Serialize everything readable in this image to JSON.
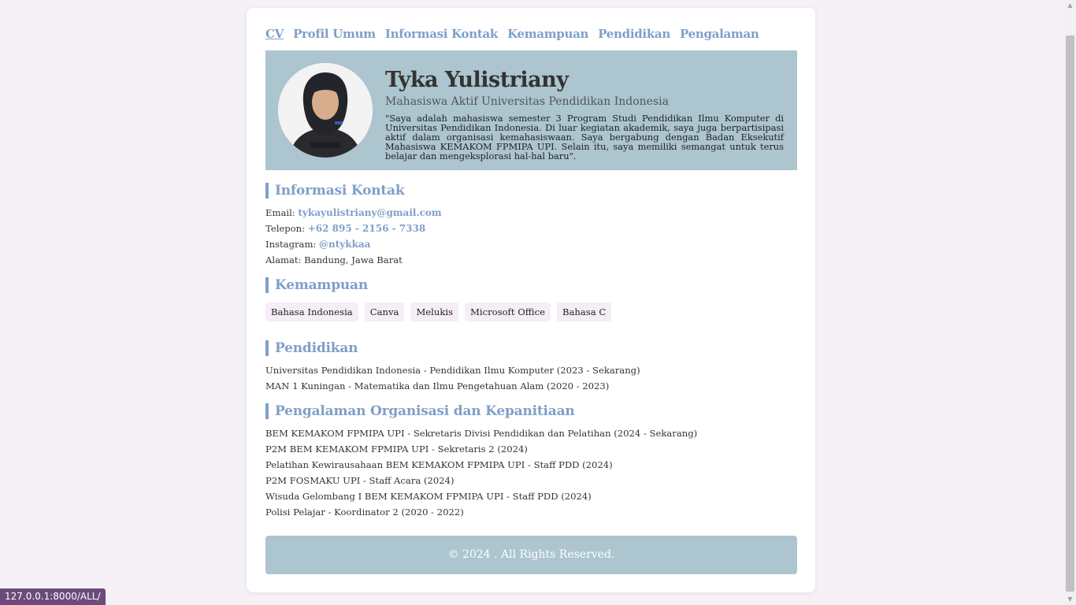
{
  "nav": {
    "items": [
      "CV",
      "Profil Umum",
      "Informasi Kontak",
      "Kemampuan",
      "Pendidikan",
      "Pengalaman"
    ]
  },
  "profile": {
    "name": "Tyka Yulistriany",
    "subtitle": "Mahasiswa Aktif Universitas Pendidikan Indonesia",
    "description": "\"Saya adalah mahasiswa semester 3 Program Studi Pendidikan Ilmu Komputer di Universitas Pendidikan Indonesia. Di luar kegiatan akademik, saya juga berpartisipasi aktif dalam organisasi kemahasiswaan. Saya bergabung dengan Badan Eksekutif Mahasiswa KEMAKOM FPMIPA UPI. Selain itu, saya memiliki semangat untuk terus belajar dan mengeksplorasi hal-hal baru\"."
  },
  "contact": {
    "title": "Informasi Kontak",
    "email_label": "Email:",
    "email": "tykayulistriany@gmail.com",
    "phone_label": "Telepon:",
    "phone": "+62 895 - 2156 - 7338",
    "instagram_label": "Instagram:",
    "instagram": "@ntykkaa",
    "address_label": "Alamat:",
    "address": "Bandung, Jawa Barat"
  },
  "skills": {
    "title": "Kemampuan",
    "items": [
      "Bahasa Indonesia",
      "Canva",
      "Melukis",
      "Microsoft Office",
      "Bahasa C"
    ]
  },
  "education": {
    "title": "Pendidikan",
    "items": [
      "Universitas Pendidikan Indonesia - Pendidikan Ilmu Komputer (2023 - Sekarang)",
      "MAN 1 Kuningan - Matematika dan Ilmu Pengetahuan Alam (2020 - 2023)"
    ]
  },
  "experience": {
    "title": "Pengalaman Organisasi dan Kepanitiaan",
    "items": [
      "BEM KEMAKOM FPMIPA UPI - Sekretaris Divisi Pendidikan dan Pelatihan (2024 - Sekarang)",
      "P2M BEM KEMAKOM FPMIPA UPI - Sekretaris 2 (2024)",
      "Pelatihan Kewirausahaan BEM KEMAKOM FPMIPA UPI - Staff PDD (2024)",
      "P2M FOSMAKU UPI - Staff Acara (2024)",
      "Wisuda Gelombang I BEM KEMAKOM FPMIPA UPI - Staff PDD (2024)",
      "Polisi Pelajar - Koordinator 2 (2020 - 2022)"
    ]
  },
  "footer": {
    "text": "© 2024 . All Rights Reserved."
  },
  "status_url": "127.0.0.1:8000/ALL/",
  "colors": {
    "accent": "#7f9fc8",
    "hero_bg": "#acc5cf",
    "page_bg": "#f6f0f7",
    "chip_bg": "#f6eef6",
    "statusbar_bg": "#6c4a7c"
  },
  "icons": [
    "profile-photo",
    "scroll-up-arrow-icon",
    "scroll-down-arrow-icon"
  ]
}
